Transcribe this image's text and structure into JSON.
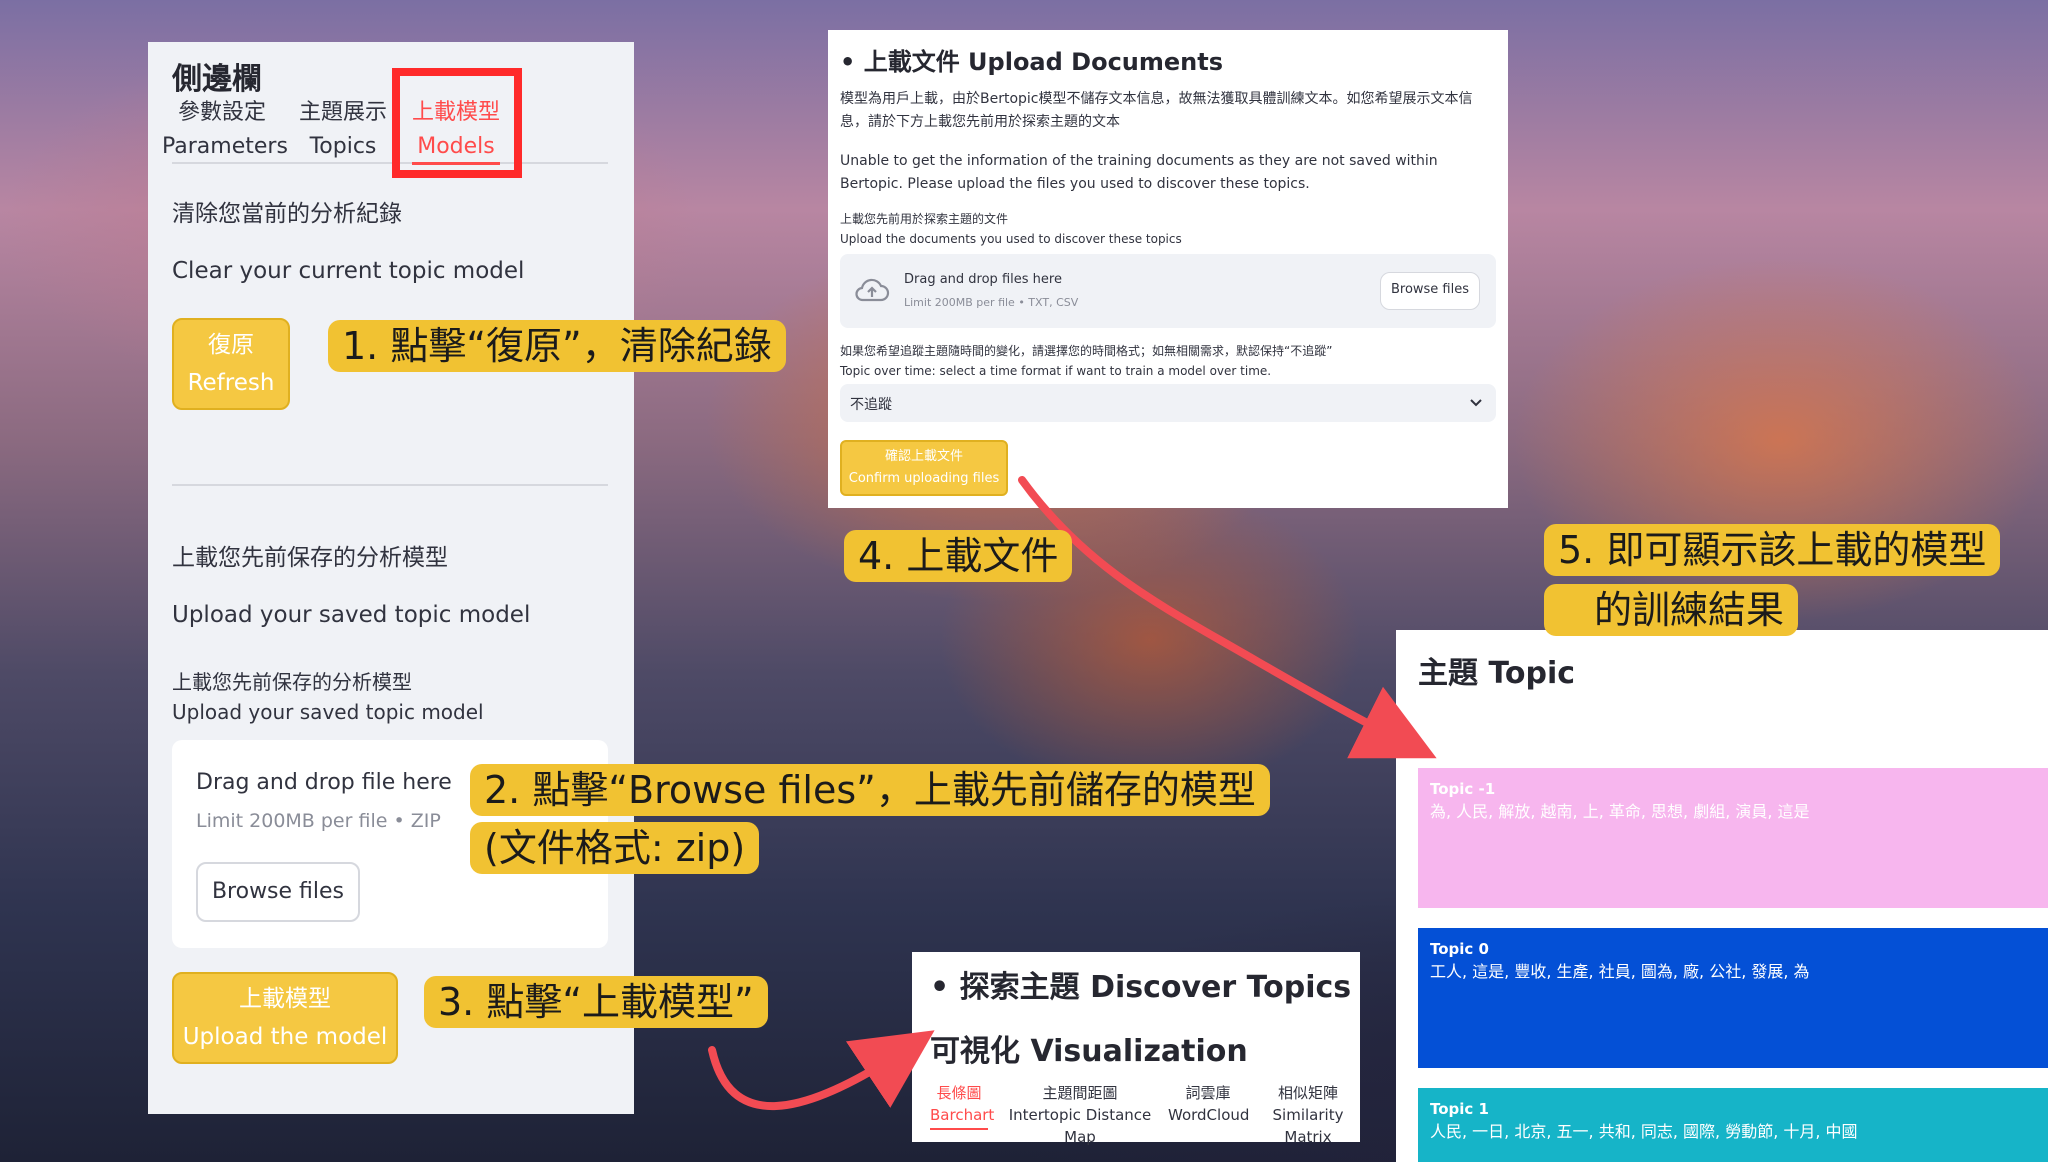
{
  "sidebar": {
    "title": "側邊欄",
    "tabs": [
      {
        "zh": "參數設定",
        "en": "Parameters"
      },
      {
        "zh": "主題展示",
        "en": "Topics"
      },
      {
        "zh": "上載模型",
        "en": "Models"
      }
    ],
    "clear_zh": "清除您當前的分析紀錄",
    "clear_en": "Clear your current topic model",
    "refresh_zh": "復原",
    "refresh_en": "Refresh",
    "upload_heading_zh": "上載您先前保存的分析模型",
    "upload_heading_en": "Upload your saved topic model",
    "upload_label_zh": "上載您先前保存的分析模型",
    "upload_label_en": "Upload your saved topic model",
    "drop_title": "Drag and drop file here",
    "drop_limit": "Limit 200MB per file • ZIP",
    "browse": "Browse files",
    "upload_btn_zh": "上載模型",
    "upload_btn_en": "Upload the model"
  },
  "upload_docs": {
    "title": "• 上載文件 Upload Documents",
    "desc_zh": "模型為用戶上載，由於Bertopic模型不儲存文本信息，故無法獲取具體訓練文本。如您希望展示文本信息，請於下方上載您先前用於探索主題的文本",
    "desc_en": "Unable to get the information of the training documents as they are not saved within Bertopic. Please upload the files you used to discover these topics.",
    "label_zh": "上載您先前用於探索主題的文件",
    "label_en": "Upload the documents you used to discover these topics",
    "drop_title": "Drag and drop files here",
    "drop_limit": "Limit 200MB per file • TXT, CSV",
    "browse": "Browse files",
    "time_zh": "如果您希望追蹤主題隨時間的變化，請選擇您的時間格式；如無相關需求，默認保持“不追蹤”",
    "time_en": "Topic over time: select a time format if want to train a model over time.",
    "select_value": "不追蹤",
    "confirm_zh": "確認上載文件",
    "confirm_en": "Confirm uploading files"
  },
  "discover": {
    "title": "• 探索主題 Discover Topics",
    "subtitle": "可視化 Visualization",
    "tabs": [
      {
        "zh": "長條圖",
        "en": "Barchart"
      },
      {
        "zh": "主題間距圖",
        "en": "Intertopic Distance Map"
      },
      {
        "zh": "詞雲庫",
        "en": "WordCloud"
      },
      {
        "zh": "相似矩陣",
        "en": "Similarity Matrix"
      }
    ]
  },
  "topic_panel": {
    "title": "主題 Topic",
    "topics": [
      {
        "name": "Topic -1",
        "words": "為, 人民, 解放, 越南, 上, 革命, 思想, 劇組, 演員, 這是",
        "color": "#f7b6ee"
      },
      {
        "name": "Topic 0",
        "words": "工人, 這是, 豐收, 生產, 社員, 圖為, 廠, 公社, 發展, 為",
        "color": "#0450d6"
      },
      {
        "name": "Topic 1",
        "words": "人民, 一日, 北京, 五一, 共和, 同志, 國際, 勞動節, 十月, 中國",
        "color": "#16b4c8"
      }
    ]
  },
  "callouts": {
    "step1": "1. 點擊“復原”，清除紀錄",
    "step2_line1": "2. 點擊“Browse files”，上載先前儲存的模型",
    "step2_line2": "(文件格式: zip)",
    "step3": "3. 點擊“上載模型”",
    "step4": "4. 上載文件",
    "step5_line1": "5. 即可顯示該上載的模型",
    "step5_line2": "的訓練結果"
  },
  "colors": {
    "accent_red": "#ff4b4b",
    "callout_yellow": "#f1c232",
    "button_yellow": "#f5c842"
  }
}
